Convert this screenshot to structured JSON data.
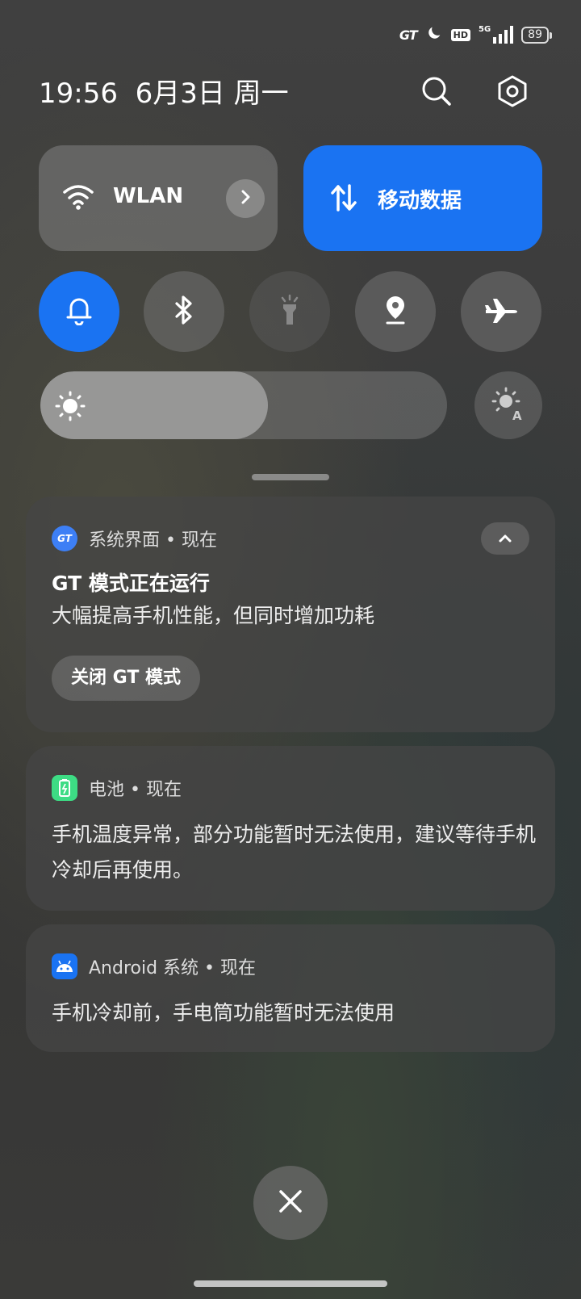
{
  "status_bar": {
    "gt_label": "GT",
    "hd_label": "HD",
    "network_label": "5G",
    "battery_level": "89",
    "icons": [
      "gt-icon",
      "moon-icon",
      "hd-icon",
      "signal-icon",
      "battery-icon"
    ]
  },
  "header": {
    "time": "19:56",
    "date": "6月3日 周一",
    "icons": [
      "search-icon",
      "settings-icon"
    ]
  },
  "tiles": {
    "wlan_label": "WLAN",
    "mobile_data_label": "移动数据",
    "wlan_on": true,
    "mobile_data_on": true
  },
  "toggles": [
    {
      "name": "bell",
      "on": true
    },
    {
      "name": "bluetooth",
      "on": false
    },
    {
      "name": "flashlight",
      "on": false,
      "disabled": true
    },
    {
      "name": "location",
      "on": false
    },
    {
      "name": "airplane",
      "on": false
    }
  ],
  "brightness": {
    "level": 0.56,
    "auto": false
  },
  "notifications": [
    {
      "app_badge": "GT",
      "app_line": "系统界面 • 现在",
      "title": "GT 模式正在运行",
      "text": "大幅提高手机性能，但同时增加功耗",
      "action": "关闭 GT 模式"
    },
    {
      "app_line": "电池 • 现在",
      "text": "手机温度异常，部分功能暂时无法使用，建议等待手机冷却后再使用。"
    },
    {
      "app_line": "Android 系统 • 现在",
      "text": "手机冷却前，手电筒功能暂时无法使用"
    }
  ],
  "colors": {
    "accent": "#1a73f2",
    "battery_app": "#3ddc84",
    "android_app": "#1a73f2"
  }
}
